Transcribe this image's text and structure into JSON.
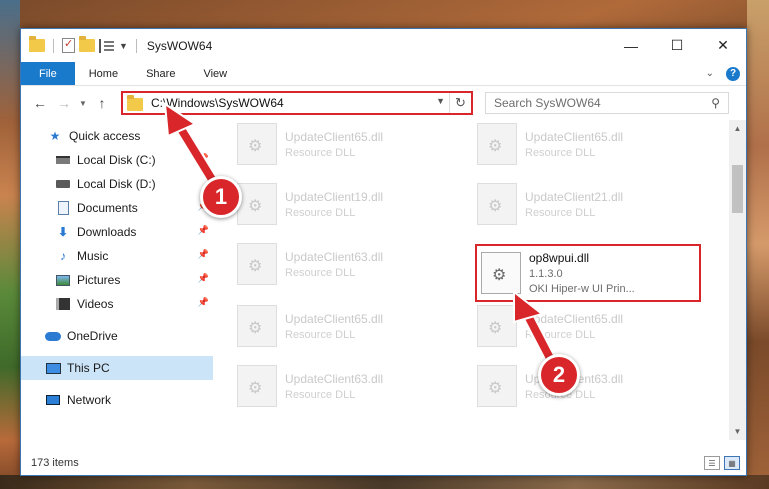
{
  "window": {
    "title": "SysWOW64",
    "controls": {
      "minimize": "—",
      "maximize": "☐",
      "close": "✕"
    }
  },
  "ribbon": {
    "tabs": [
      "File",
      "Home",
      "Share",
      "View"
    ]
  },
  "navigation": {
    "back": "←",
    "forward": "→",
    "up": "↑",
    "address": "C:\\Windows\\SysWOW64",
    "search_placeholder": "Search SysWOW64"
  },
  "sidebar": {
    "items": [
      {
        "label": "Quick access"
      },
      {
        "label": "Local Disk (C:)"
      },
      {
        "label": "Local Disk (D:)"
      },
      {
        "label": "Documents"
      },
      {
        "label": "Downloads"
      },
      {
        "label": "Music"
      },
      {
        "label": "Pictures"
      },
      {
        "label": "Videos"
      },
      {
        "label": "OneDrive"
      },
      {
        "label": "This PC"
      },
      {
        "label": "Network"
      }
    ]
  },
  "files": [
    {
      "name": "UpdateClient65.dll",
      "desc": "Resource DLL"
    },
    {
      "name": "UpdateClient65.dll",
      "desc": "Resource DLL"
    },
    {
      "name": "UpdateClient19.dll",
      "desc": "Resource DLL"
    },
    {
      "name": "UpdateClient21.dll",
      "desc": "Resource DLL"
    },
    {
      "name": "UpdateClient63.dll",
      "desc": "Resource DLL"
    },
    {
      "name": "op8wpui.dll",
      "desc": "1.1.3.0",
      "desc2": "OKI Hiper-w UI Prin..."
    },
    {
      "name": "UpdateClient65.dll",
      "desc": "Resource DLL"
    },
    {
      "name": "UpdateClient65.dll",
      "desc": "Resource DLL"
    },
    {
      "name": "UpdateClient63.dll",
      "desc": "Resource DLL"
    },
    {
      "name": "UpdateClient63.dll",
      "desc": "Resource DLL"
    }
  ],
  "status": {
    "item_count": "173 items"
  },
  "callouts": [
    "1",
    "2"
  ],
  "colors": {
    "accent": "#1979ca",
    "highlight": "#d9262a",
    "selected": "#cce4f7"
  }
}
